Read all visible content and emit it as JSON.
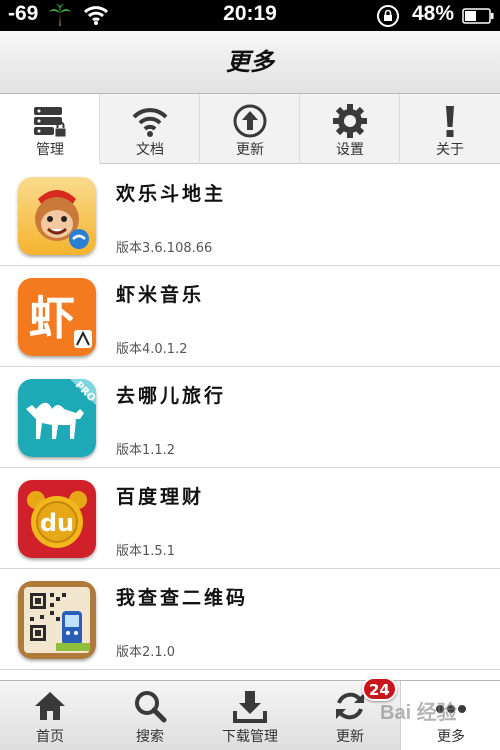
{
  "status_bar": {
    "signal": "-69",
    "time": "20:19",
    "battery_percent": "48%",
    "battery_level": 0.48
  },
  "header": {
    "title": "更多"
  },
  "tabs": [
    {
      "label": "管理",
      "icon": "server-lock-icon",
      "active": true
    },
    {
      "label": "文档",
      "icon": "wifi-icon",
      "active": false
    },
    {
      "label": "更新",
      "icon": "upload-arrow-icon",
      "active": false
    },
    {
      "label": "设置",
      "icon": "gear-icon",
      "active": false
    },
    {
      "label": "关于",
      "icon": "exclamation-icon",
      "active": false
    }
  ],
  "apps": [
    {
      "name": "欢乐斗地主",
      "version": "版本3.6.108.66",
      "icon": "doudizhu-app-icon"
    },
    {
      "name": "虾米音乐",
      "version": "版本4.0.1.2",
      "icon": "xiami-app-icon",
      "icon_text": "虾"
    },
    {
      "name": "去哪儿旅行",
      "version": "版本1.1.2",
      "icon": "qunar-app-icon",
      "icon_text": "PRO"
    },
    {
      "name": "百度理财",
      "version": "版本1.5.1",
      "icon": "baidu-licai-app-icon",
      "icon_text": "du"
    },
    {
      "name": "我查查二维码",
      "version": "版本2.1.0",
      "icon": "qr-scanner-app-icon"
    }
  ],
  "bottom_nav": [
    {
      "label": "首页",
      "icon": "home-icon"
    },
    {
      "label": "搜索",
      "icon": "search-icon"
    },
    {
      "label": "下载管理",
      "icon": "download-icon"
    },
    {
      "label": "更新",
      "icon": "refresh-icon",
      "badge": "24"
    },
    {
      "label": "更多",
      "icon": "more-dots-icon",
      "active": true
    }
  ],
  "watermark": "Bai 经验",
  "colors": {
    "status_bar_bg": "#000000",
    "badge_red": "#c8161d",
    "icon_dark": "#3a3a3a",
    "xiami_orange": "#f47a1f",
    "qunar_teal": "#1ea9b7",
    "baidu_red": "#d0202a"
  }
}
